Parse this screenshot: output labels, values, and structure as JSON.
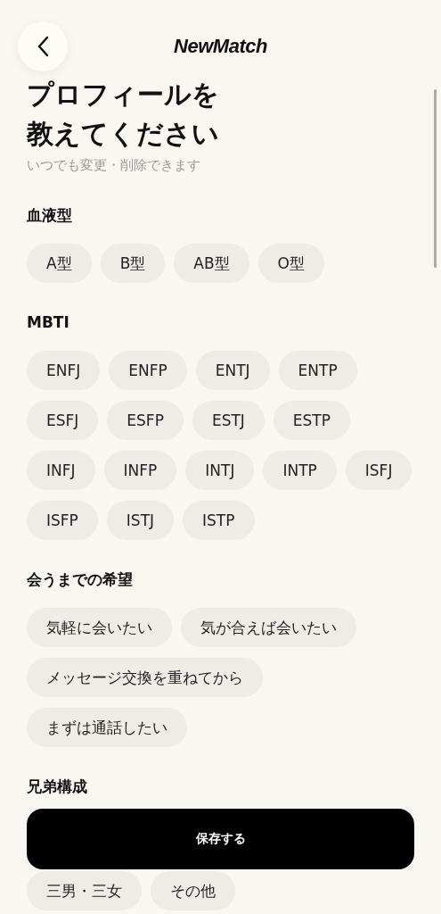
{
  "header": {
    "logo": "NewMatch"
  },
  "title_lines": [
    "プロフィールを",
    "教えてください"
  ],
  "subtitle": "いつでも変更・削除できます",
  "sections": [
    {
      "title": "血液型",
      "options": [
        {
          "label": "A型",
          "selected": false
        },
        {
          "label": "B型",
          "selected": false
        },
        {
          "label": "AB型",
          "selected": false
        },
        {
          "label": "O型",
          "selected": false
        }
      ]
    },
    {
      "title": "MBTI",
      "options": [
        {
          "label": "ENFJ",
          "selected": false
        },
        {
          "label": "ENFP",
          "selected": false
        },
        {
          "label": "ENTJ",
          "selected": false
        },
        {
          "label": "ENTP",
          "selected": false
        },
        {
          "label": "ESFJ",
          "selected": false
        },
        {
          "label": "ESFP",
          "selected": false
        },
        {
          "label": "ESTJ",
          "selected": false
        },
        {
          "label": "ESTP",
          "selected": false
        },
        {
          "label": "INFJ",
          "selected": false
        },
        {
          "label": "INFP",
          "selected": false
        },
        {
          "label": "INTJ",
          "selected": false
        },
        {
          "label": "INTP",
          "selected": false
        },
        {
          "label": "ISFJ",
          "selected": false
        },
        {
          "label": "ISFP",
          "selected": false
        },
        {
          "label": "ISTJ",
          "selected": false
        },
        {
          "label": "ISTP",
          "selected": false
        }
      ]
    },
    {
      "title": "会うまでの希望",
      "options": [
        {
          "label": "気軽に会いたい",
          "selected": false
        },
        {
          "label": "気が合えば会いたい",
          "selected": false
        },
        {
          "label": "メッセージ交換を重ねてから",
          "selected": false
        },
        {
          "label": "まずは通話したい",
          "selected": false
        }
      ]
    },
    {
      "title": "兄弟構成",
      "options": [
        {
          "label": "三男・三女",
          "selected": false
        },
        {
          "label": "その他",
          "selected": false
        }
      ]
    }
  ],
  "save_button": {
    "label": "保存する"
  }
}
